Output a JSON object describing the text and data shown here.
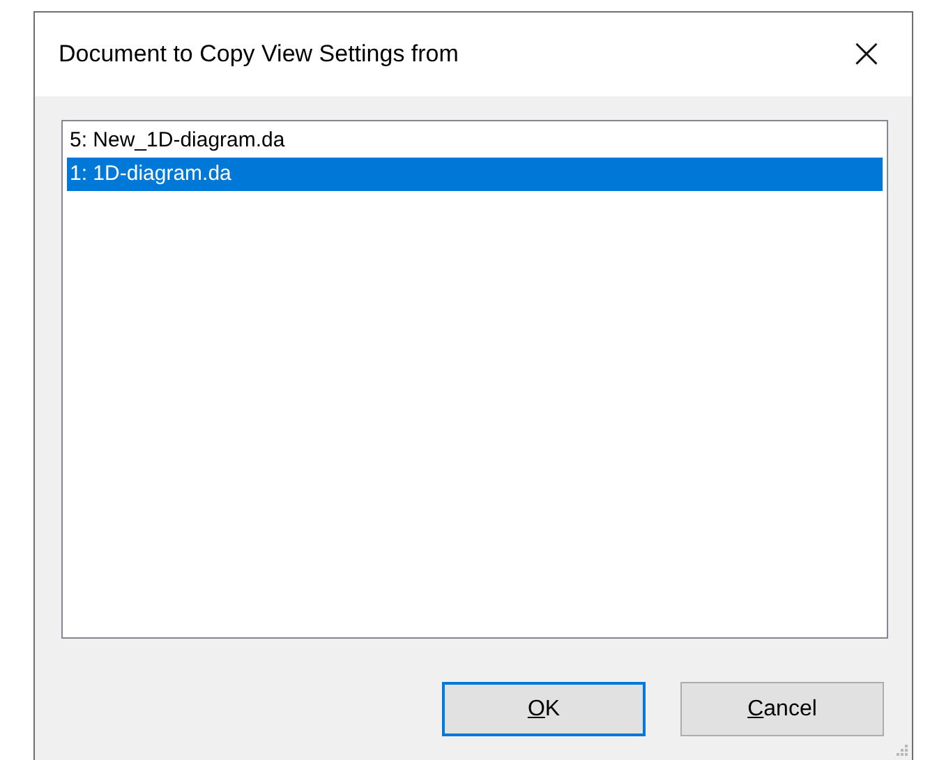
{
  "window": {
    "title": "Document to Copy View Settings from",
    "close": "×"
  },
  "documents": [
    {
      "label": "5: New_1D-diagram.da",
      "selected": false
    },
    {
      "label": "1: 1D-diagram.da",
      "selected": true
    }
  ],
  "buttons": [
    {
      "label": "OK",
      "default": true,
      "underline_first": true
    },
    {
      "label": "Cancel",
      "default": false,
      "underline_first": true
    }
  ]
}
